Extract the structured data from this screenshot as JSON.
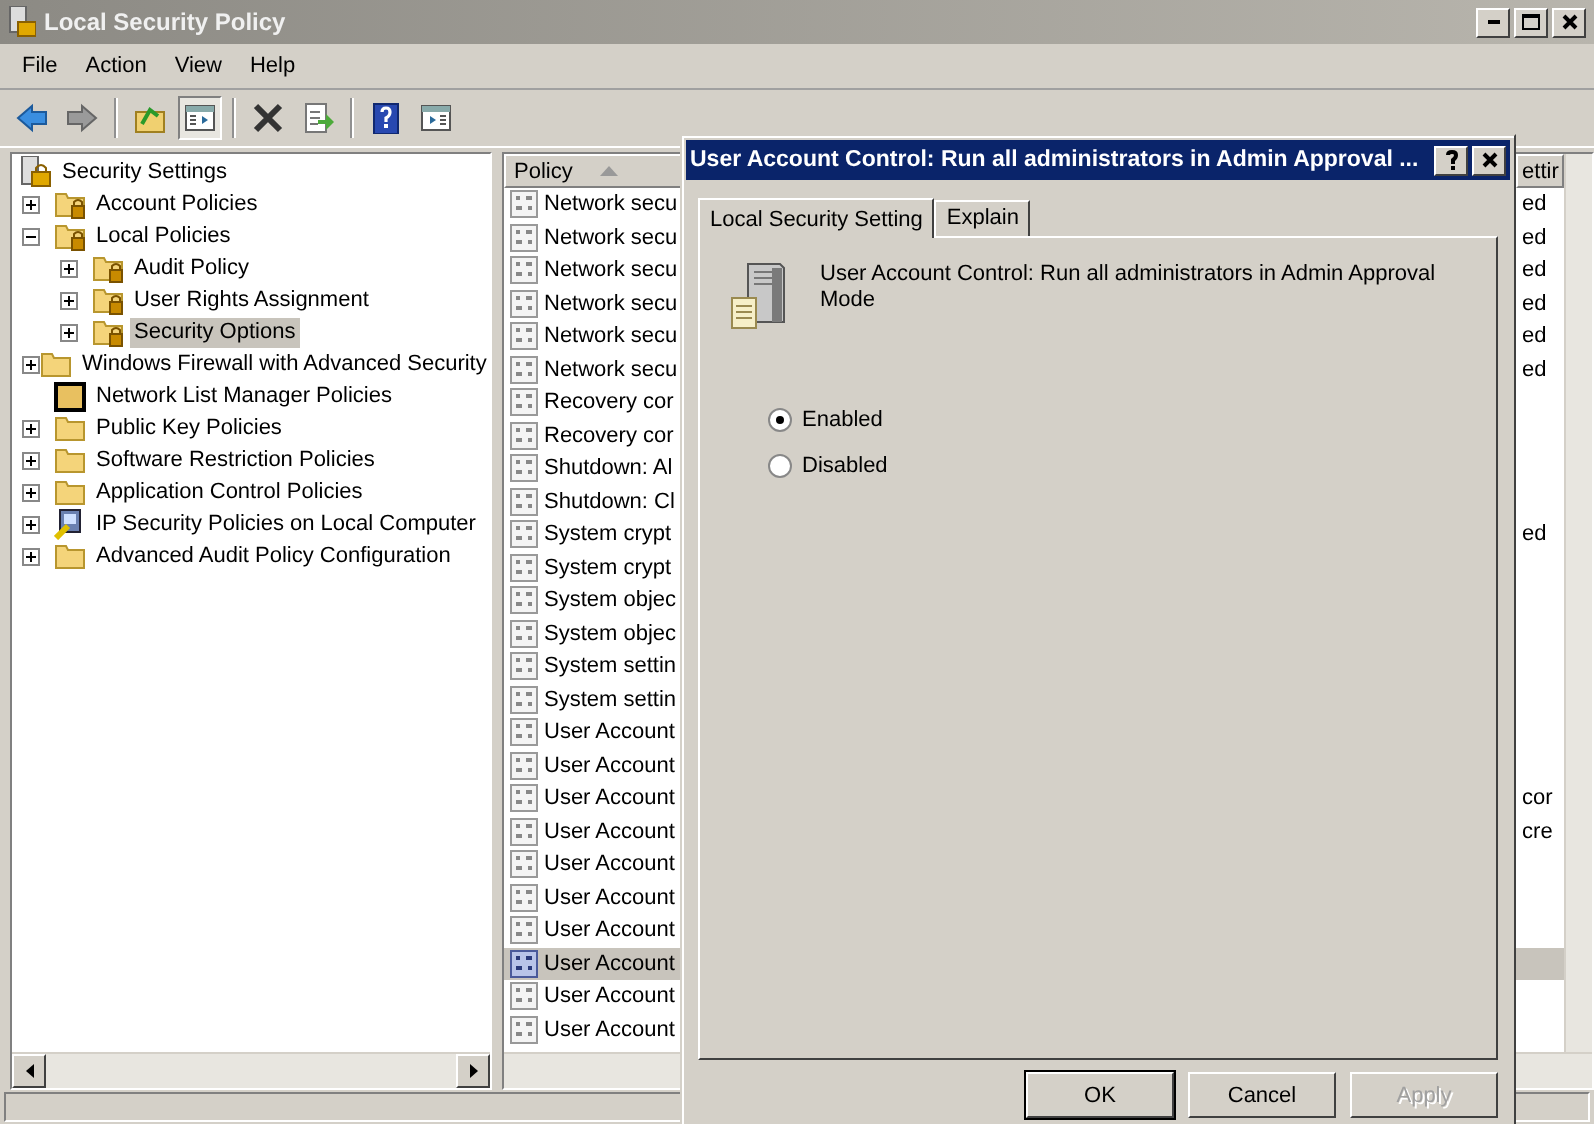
{
  "window": {
    "title": "Local Security Policy"
  },
  "menu": [
    "File",
    "Action",
    "View",
    "Help"
  ],
  "toolbar": [
    {
      "kind": "back",
      "pressed": false
    },
    {
      "kind": "forward",
      "pressed": false
    },
    {
      "kind": "sep"
    },
    {
      "kind": "up",
      "pressed": false
    },
    {
      "kind": "tree",
      "pressed": true
    },
    {
      "kind": "sep"
    },
    {
      "kind": "delete",
      "pressed": false
    },
    {
      "kind": "export",
      "pressed": false
    },
    {
      "kind": "sep"
    },
    {
      "kind": "help",
      "pressed": false
    },
    {
      "kind": "pane",
      "pressed": false
    }
  ],
  "tree": {
    "root": {
      "label": "Security Settings",
      "selected": false
    },
    "items": [
      {
        "label": "Account Policies",
        "kind": "lock-folder",
        "expanded": false,
        "selected": false
      },
      {
        "label": "Local Policies",
        "kind": "lock-folder",
        "expanded": true,
        "selected": false,
        "children": [
          {
            "label": "Audit Policy",
            "kind": "lock-folder",
            "expanded": false,
            "selected": false
          },
          {
            "label": "User Rights Assignment",
            "kind": "lock-folder",
            "expanded": false,
            "selected": false
          },
          {
            "label": "Security Options",
            "kind": "lock-folder",
            "expanded": false,
            "selected": true
          }
        ]
      },
      {
        "label": "Windows Firewall with Advanced Security",
        "kind": "folder",
        "expanded": false,
        "selected": false
      },
      {
        "label": "Network List Manager Policies",
        "kind": "dark-folder",
        "selected": false
      },
      {
        "label": "Public Key Policies",
        "kind": "folder",
        "expanded": false,
        "selected": false
      },
      {
        "label": "Software Restriction Policies",
        "kind": "folder",
        "expanded": false,
        "selected": false
      },
      {
        "label": "Application Control Policies",
        "kind": "folder",
        "expanded": false,
        "selected": false
      },
      {
        "label": "IP Security Policies on Local Computer",
        "kind": "ip-security",
        "expanded": false,
        "selected": false
      },
      {
        "label": "Advanced Audit Policy Configuration",
        "kind": "folder",
        "expanded": false,
        "selected": false
      }
    ]
  },
  "list": {
    "columns": [
      {
        "label": "Policy",
        "sorted": true
      },
      {
        "label": "ettir",
        "sorted": false
      }
    ],
    "rows": [
      {
        "policy": "Network secu",
        "setting": "ed",
        "selected": false
      },
      {
        "policy": "Network secu",
        "setting": "ed",
        "selected": false
      },
      {
        "policy": "Network secu",
        "setting": "ed",
        "selected": false
      },
      {
        "policy": "Network secu",
        "setting": "ed",
        "selected": false
      },
      {
        "policy": "Network secu",
        "setting": "ed",
        "selected": false
      },
      {
        "policy": "Network secu",
        "setting": "ed",
        "selected": false
      },
      {
        "policy": "Recovery cor",
        "selected": false
      },
      {
        "policy": "Recovery cor",
        "selected": false
      },
      {
        "policy": "Shutdown: Al",
        "selected": false
      },
      {
        "policy": "Shutdown: Cl",
        "selected": false
      },
      {
        "policy": "System crypt",
        "setting": "ed",
        "selected": false
      },
      {
        "policy": "System crypt",
        "selected": false
      },
      {
        "policy": "System objec",
        "selected": false
      },
      {
        "policy": "System objec",
        "selected": false
      },
      {
        "policy": "System settin",
        "selected": false
      },
      {
        "policy": "System settin",
        "selected": false
      },
      {
        "policy": "User Account",
        "selected": false
      },
      {
        "policy": "User Account",
        "selected": false
      },
      {
        "policy": "User Account",
        "setting": "cor",
        "selected": false
      },
      {
        "policy": "User Account",
        "setting": "cre",
        "selected": false
      },
      {
        "policy": "User Account",
        "selected": false
      },
      {
        "policy": "User Account",
        "selected": false
      },
      {
        "policy": "User Account",
        "selected": false
      },
      {
        "policy": "User Account",
        "selected": true
      },
      {
        "policy": "User Account",
        "selected": false
      },
      {
        "policy": "User Account",
        "selected": false
      }
    ]
  },
  "dialog": {
    "title": "User Account Control: Run all administrators in Admin Approval ...",
    "tabs": [
      {
        "label": "Local Security Setting",
        "selected": true
      },
      {
        "label": "Explain",
        "selected": false
      }
    ],
    "description": "User Account Control: Run all administrators in Admin Approval Mode",
    "options": [
      {
        "label": "Enabled",
        "selected": true
      },
      {
        "label": "Disabled",
        "selected": false
      }
    ],
    "buttons": [
      {
        "label": "OK",
        "default": true,
        "disabled": false
      },
      {
        "label": "Cancel",
        "default": false,
        "disabled": false
      },
      {
        "label": "Apply",
        "default": false,
        "disabled": true
      }
    ]
  }
}
